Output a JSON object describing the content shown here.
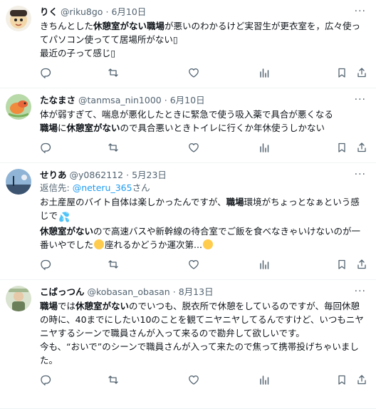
{
  "tweets": [
    {
      "name": "りく",
      "handle": "@riku8go",
      "sep": "·",
      "date": "6月10日",
      "more": "···",
      "text": [
        {
          "t": "きちんとした"
        },
        {
          "t": "休憩室がない職場",
          "b": true
        },
        {
          "t": "が悪いのわかるけど実習生が更衣室を，広々使ってパソコン使ってて居場所がない▯"
        },
        {
          "br": true
        },
        {
          "t": "最近の子って感じ▯"
        }
      ]
    },
    {
      "name": "たなまさ",
      "handle": "@tanmsa_nin1000",
      "sep": "·",
      "date": "6月10日",
      "more": "···",
      "text": [
        {
          "t": "体が弱すぎて、喘息が悪化したときに緊急で使う吸入薬で具合が悪くなる"
        },
        {
          "br": true
        },
        {
          "t": "職場",
          "b": true
        },
        {
          "t": "に"
        },
        {
          "t": "休憩室がない",
          "b": true
        },
        {
          "t": "ので具合悪いときトイレに行くか年休使うしかない"
        }
      ]
    },
    {
      "name": "せりあ",
      "handle": "@y0862112",
      "sep": "·",
      "date": "5月23日",
      "more": "···",
      "reply_prefix": "返信先: ",
      "reply_mention": "@neteru_365",
      "reply_suffix": "さん",
      "text": [
        {
          "t": "お土産屋のバイト自体は楽しかったんですが、"
        },
        {
          "t": "職場",
          "b": true
        },
        {
          "t": "環境がちょっとなぁという感じで"
        },
        {
          "emoji": "drops"
        },
        {
          "br": true
        },
        {
          "t": "休憩室がない",
          "b": true
        },
        {
          "t": "ので高速バスや新幹線の待合室でご飯を食べなきゃいけないのが一番いやでした"
        },
        {
          "emoji": "cry"
        },
        {
          "t": "座れるかどうか運次第..."
        },
        {
          "emoji": "smile"
        }
      ]
    },
    {
      "name": "こばっつん",
      "handle": "@kobasan_obasan",
      "sep": "·",
      "date": "8月13日",
      "more": "···",
      "text": [
        {
          "t": "職場",
          "b": true
        },
        {
          "t": "では"
        },
        {
          "t": "休憩室がない",
          "b": true
        },
        {
          "t": "のでいつも、脱衣所で休憩をしているのですが、毎回休憩の時に、40までにしたい10のことを観てニヤニヤしてるんですけど、いつもニヤニヤするシーンで職員さんが入って来るので勘弁して欲しいです。"
        },
        {
          "br": true
        },
        {
          "t": "今も、“おいで”のシーンで職員さんが入って来たので焦って携帯投げちゃいました。"
        }
      ]
    }
  ]
}
